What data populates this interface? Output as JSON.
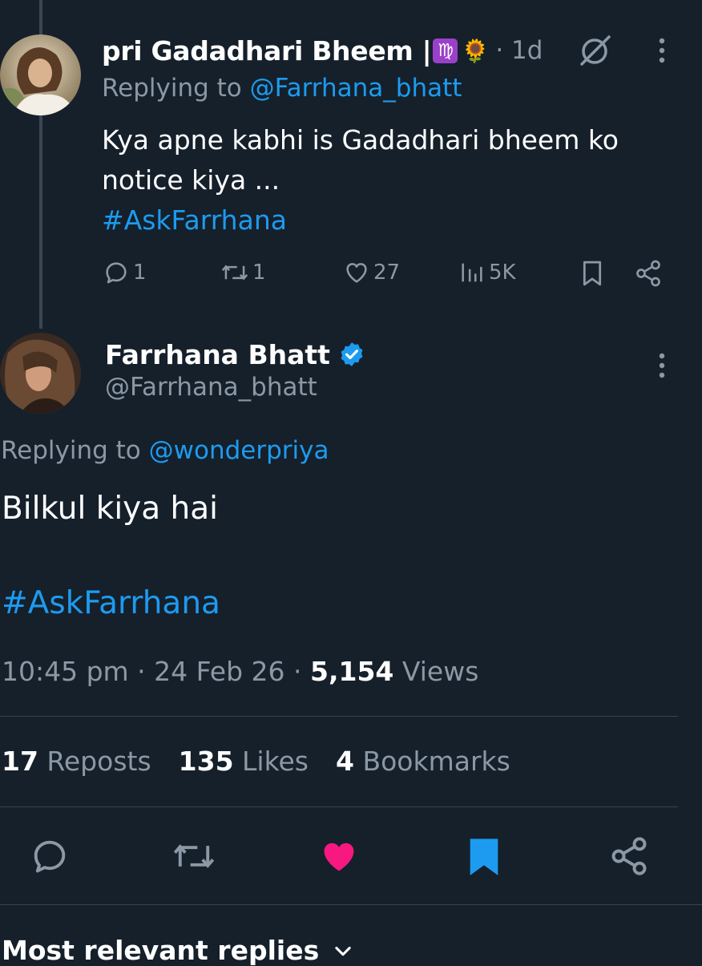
{
  "reply_tweet": {
    "display_name": "pri Gadadhari Bheem | ",
    "virgo_emoji": "♍",
    "sunflower_emoji": "🌻",
    "time": "· 1d",
    "replying_prefix": "Replying to ",
    "replying_handle": "@Farrhana_bhatt",
    "text_line1": "Kya apne kabhi is Gadadhari bheem ko",
    "text_line2": "notice kiya ...",
    "hashtag": "#AskFarrhana",
    "stats": {
      "replies": "1",
      "reposts": "1",
      "likes": "27",
      "views": "5K"
    }
  },
  "main_tweet": {
    "display_name": "Farrhana Bhatt",
    "handle": "@Farrhana_bhatt",
    "replying_prefix": "Replying to ",
    "replying_handle": "@wonderpriya",
    "text": "Bilkul kiya hai",
    "hashtag": "#AskFarrhana",
    "timestamp": "10:45 pm · 24 Feb 26 · ",
    "views_count": "5,154",
    "views_label": " Views",
    "engagement": {
      "reposts_count": "17",
      "reposts_label": " Reposts",
      "likes_count": "135",
      "likes_label": " Likes",
      "bookmarks_count": "4",
      "bookmarks_label": " Bookmarks"
    }
  },
  "footer": {
    "sort_label": "Most relevant replies"
  },
  "colors": {
    "background": "#15202b",
    "accent": "#1d9bf0",
    "like": "#f91880",
    "muted": "#8b98a5"
  }
}
